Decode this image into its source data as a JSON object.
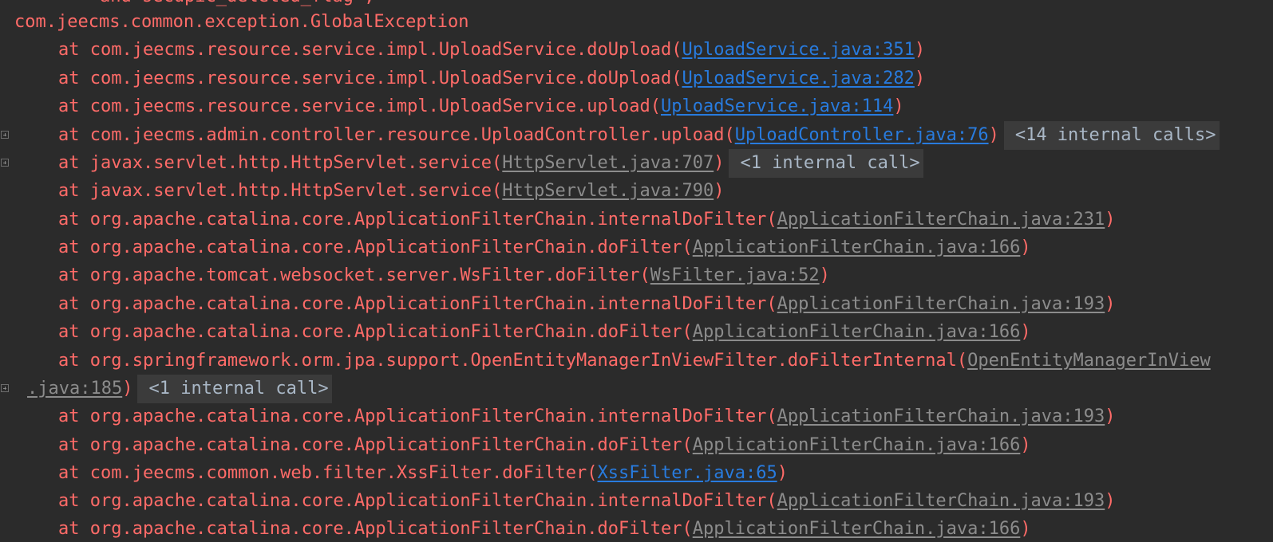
{
  "console": {
    "top_partial_line": "and secupic_deleted_flag ,",
    "exception_line": "com.jeecms.common.exception.GlobalException",
    "frames": [
      {
        "prefix": "at com.jeecms.resource.service.impl.UploadService.doUpload(",
        "link": "UploadService.java:351",
        "suffix": ")",
        "link_kind": "user",
        "internal": "",
        "folded": false
      },
      {
        "prefix": "at com.jeecms.resource.service.impl.UploadService.doUpload(",
        "link": "UploadService.java:282",
        "suffix": ")",
        "link_kind": "user",
        "internal": "",
        "folded": false
      },
      {
        "prefix": "at com.jeecms.resource.service.impl.UploadService.upload(",
        "link": "UploadService.java:114",
        "suffix": ")",
        "link_kind": "user",
        "internal": "",
        "folded": false
      },
      {
        "prefix": "at com.jeecms.admin.controller.resource.UploadController.upload(",
        "link": "UploadController.java:76",
        "suffix": ")",
        "link_kind": "user",
        "internal": "<14 internal calls>",
        "folded": true
      },
      {
        "prefix": "at javax.servlet.http.HttpServlet.service(",
        "link": "HttpServlet.java:707",
        "suffix": ")",
        "link_kind": "lib",
        "internal": "<1 internal call>",
        "folded": true
      },
      {
        "prefix": "at javax.servlet.http.HttpServlet.service(",
        "link": "HttpServlet.java:790",
        "suffix": ")",
        "link_kind": "lib",
        "internal": "",
        "folded": false
      },
      {
        "prefix": "at org.apache.catalina.core.ApplicationFilterChain.internalDoFilter(",
        "link": "ApplicationFilterChain.java:231",
        "suffix": ")",
        "link_kind": "lib",
        "internal": "",
        "folded": false
      },
      {
        "prefix": "at org.apache.catalina.core.ApplicationFilterChain.doFilter(",
        "link": "ApplicationFilterChain.java:166",
        "suffix": ")",
        "link_kind": "lib",
        "internal": "",
        "folded": false
      },
      {
        "prefix": "at org.apache.tomcat.websocket.server.WsFilter.doFilter(",
        "link": "WsFilter.java:52",
        "suffix": ")",
        "link_kind": "lib",
        "internal": "",
        "folded": false
      },
      {
        "prefix": "at org.apache.catalina.core.ApplicationFilterChain.internalDoFilter(",
        "link": "ApplicationFilterChain.java:193",
        "suffix": ")",
        "link_kind": "lib",
        "internal": "",
        "folded": false
      },
      {
        "prefix": "at org.apache.catalina.core.ApplicationFilterChain.doFilter(",
        "link": "ApplicationFilterChain.java:166",
        "suffix": ")",
        "link_kind": "lib",
        "internal": "",
        "folded": false
      },
      {
        "prefix": "at org.springframework.orm.jpa.support.OpenEntityManagerInViewFilter.doFilterInternal(",
        "link": "OpenEntityManagerInView",
        "suffix": "",
        "link_kind": "lib",
        "internal": "",
        "folded": false
      }
    ],
    "wrapped_line": {
      "link": ".java:185",
      "suffix": ")",
      "internal": "<1 internal call>"
    },
    "frames_after": [
      {
        "prefix": "at org.apache.catalina.core.ApplicationFilterChain.internalDoFilter(",
        "link": "ApplicationFilterChain.java:193",
        "suffix": ")",
        "link_kind": "lib"
      },
      {
        "prefix": "at org.apache.catalina.core.ApplicationFilterChain.doFilter(",
        "link": "ApplicationFilterChain.java:166",
        "suffix": ")",
        "link_kind": "lib"
      },
      {
        "prefix": "at com.jeecms.common.web.filter.XssFilter.doFilter(",
        "link": "XssFilter.java:65",
        "suffix": ")",
        "link_kind": "user"
      },
      {
        "prefix": "at org.apache.catalina.core.ApplicationFilterChain.internalDoFilter(",
        "link": "ApplicationFilterChain.java:193",
        "suffix": ")",
        "link_kind": "lib"
      },
      {
        "prefix": "at org.apache.catalina.core.ApplicationFilterChain.doFilter(",
        "link": "ApplicationFilterChain.java:166",
        "suffix": ")",
        "link_kind": "lib"
      }
    ],
    "colors": {
      "background": "#2b2b2b",
      "error_text": "#ff6b68",
      "user_link": "#287bde",
      "library_link": "#8c8c8c",
      "internal_calls_bg": "#3b3b3b"
    }
  }
}
